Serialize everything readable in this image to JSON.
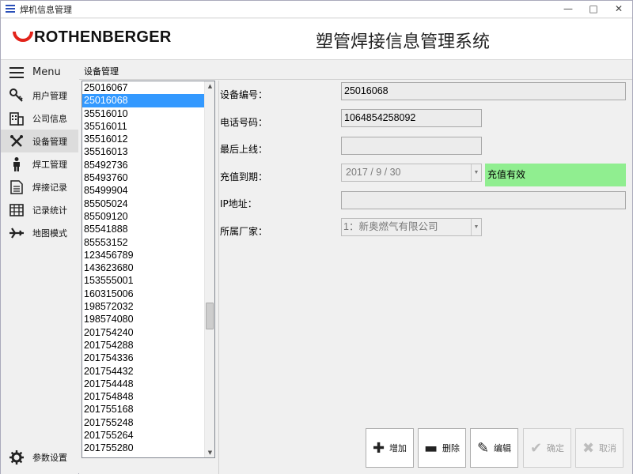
{
  "window": {
    "title": "焊机信息管理",
    "min": "—",
    "max": "□",
    "close": "✕"
  },
  "header": {
    "logo_text": "ROTHENBERGER",
    "system_title": "塑管焊接信息管理系统"
  },
  "nav": {
    "menu_label": "Menu",
    "items": [
      {
        "label": "用户管理",
        "icon": "key-icon"
      },
      {
        "label": "公司信息",
        "icon": "building-icon"
      },
      {
        "label": "设备管理",
        "icon": "tools-icon",
        "active": true
      },
      {
        "label": "焊工管理",
        "icon": "person-icon"
      },
      {
        "label": "焊接记录",
        "icon": "document-icon"
      },
      {
        "label": "记录统计",
        "icon": "table-icon"
      },
      {
        "label": "地图模式",
        "icon": "airplane-icon"
      }
    ],
    "settings_label": "参数设置"
  },
  "section_title": "设备管理",
  "device_list": {
    "selected": "25016068",
    "items": [
      "25016067",
      "25016068",
      "35516010",
      "35516011",
      "35516012",
      "35516013",
      "85492736",
      "85493760",
      "85499904",
      "85505024",
      "85509120",
      "85541888",
      "85553152",
      "123456789",
      "143623680",
      "153555001",
      "160315006",
      "198572032",
      "198574080",
      "201754240",
      "201754288",
      "201754336",
      "201754432",
      "201754448",
      "201754848",
      "201755168",
      "201755248",
      "201755264",
      "201755280"
    ]
  },
  "form": {
    "device_no": {
      "label": "设备编号：",
      "value": "25016068"
    },
    "phone": {
      "label": "电话号码：",
      "value": "1064854258092"
    },
    "last_online": {
      "label": "最后上线：",
      "value": ""
    },
    "recharge": {
      "label": "充值到期：",
      "value": "2017 / 9 / 30",
      "status": "充值有效",
      "status_color": "#90ee90"
    },
    "ip": {
      "label": "IP地址：",
      "value": ""
    },
    "manufacturer": {
      "label": "所属厂家：",
      "value": "1：新奥燃气有限公司"
    }
  },
  "buttons": {
    "add": "增加",
    "delete": "删除",
    "edit": "编辑",
    "confirm": "确定",
    "cancel": "取消"
  }
}
